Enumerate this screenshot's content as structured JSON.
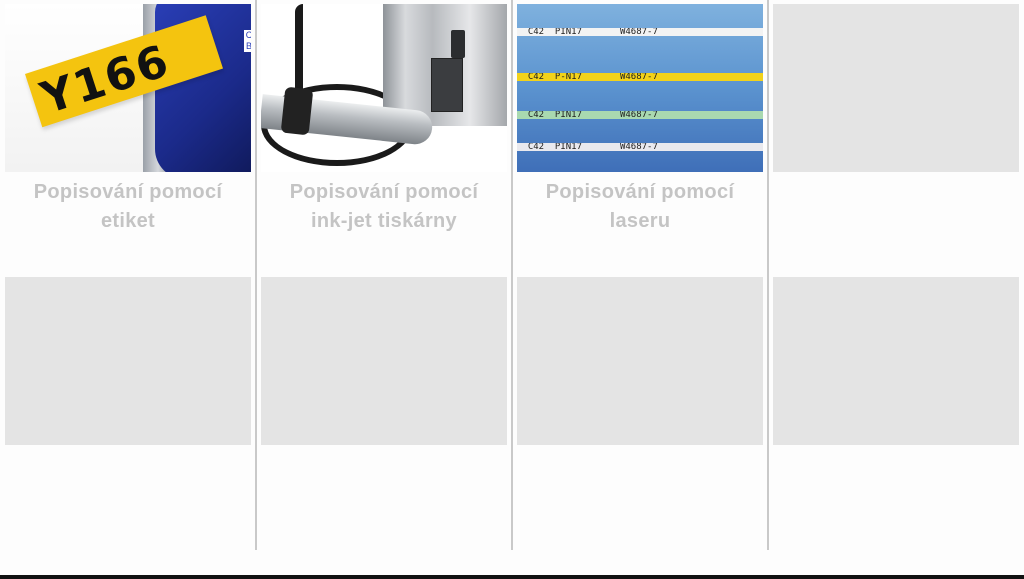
{
  "captions": [
    {
      "line1": "Popisování pomocí",
      "line2": "etiket"
    },
    {
      "line1": "Popisování pomocí",
      "line2": "ink-jet tiskárny"
    },
    {
      "line1": "Popisování pomocí",
      "line2": "laseru"
    }
  ],
  "label_printer": {
    "label_text": "Y166",
    "brand_text": "C B"
  },
  "laser_cables": [
    {
      "text": "C42  PIN17       W4687-7",
      "color": "#f3f3f3"
    },
    {
      "text": "C42  P-N17       W4687-7",
      "color": "#f2d21a"
    },
    {
      "text": "C42  PIN17       W4687-7",
      "color": "#a9d9b0"
    },
    {
      "text": "C42  PIN17       W4687-7",
      "color": "#e9e9ee"
    }
  ],
  "colors": {
    "caption": "#c4c4c4",
    "placeholder": "#e4e4e4",
    "divider": "#c9c9c9",
    "label_yellow": "#f4c40f",
    "printer_blue": "#2a3fb8"
  }
}
